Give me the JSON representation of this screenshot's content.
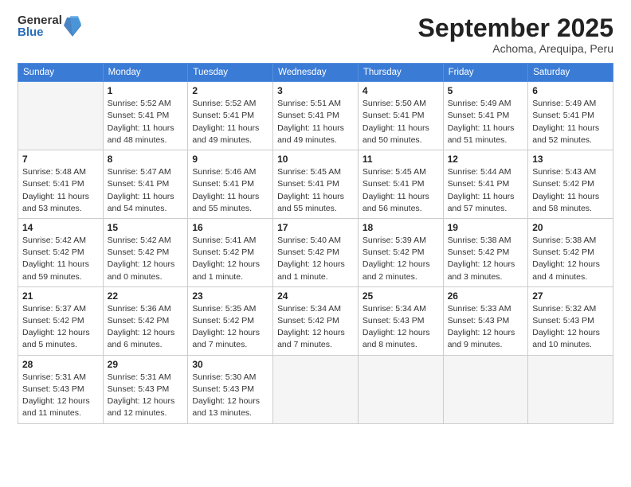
{
  "logo": {
    "general": "General",
    "blue": "Blue"
  },
  "title": "September 2025",
  "location": "Achoma, Arequipa, Peru",
  "days_of_week": [
    "Sunday",
    "Monday",
    "Tuesday",
    "Wednesday",
    "Thursday",
    "Friday",
    "Saturday"
  ],
  "weeks": [
    [
      {
        "day": "",
        "empty": true
      },
      {
        "day": "1",
        "sunrise": "Sunrise: 5:52 AM",
        "sunset": "Sunset: 5:41 PM",
        "daylight": "Daylight: 11 hours and 48 minutes."
      },
      {
        "day": "2",
        "sunrise": "Sunrise: 5:52 AM",
        "sunset": "Sunset: 5:41 PM",
        "daylight": "Daylight: 11 hours and 49 minutes."
      },
      {
        "day": "3",
        "sunrise": "Sunrise: 5:51 AM",
        "sunset": "Sunset: 5:41 PM",
        "daylight": "Daylight: 11 hours and 49 minutes."
      },
      {
        "day": "4",
        "sunrise": "Sunrise: 5:50 AM",
        "sunset": "Sunset: 5:41 PM",
        "daylight": "Daylight: 11 hours and 50 minutes."
      },
      {
        "day": "5",
        "sunrise": "Sunrise: 5:49 AM",
        "sunset": "Sunset: 5:41 PM",
        "daylight": "Daylight: 11 hours and 51 minutes."
      },
      {
        "day": "6",
        "sunrise": "Sunrise: 5:49 AM",
        "sunset": "Sunset: 5:41 PM",
        "daylight": "Daylight: 11 hours and 52 minutes."
      }
    ],
    [
      {
        "day": "7",
        "sunrise": "Sunrise: 5:48 AM",
        "sunset": "Sunset: 5:41 PM",
        "daylight": "Daylight: 11 hours and 53 minutes."
      },
      {
        "day": "8",
        "sunrise": "Sunrise: 5:47 AM",
        "sunset": "Sunset: 5:41 PM",
        "daylight": "Daylight: 11 hours and 54 minutes."
      },
      {
        "day": "9",
        "sunrise": "Sunrise: 5:46 AM",
        "sunset": "Sunset: 5:41 PM",
        "daylight": "Daylight: 11 hours and 55 minutes."
      },
      {
        "day": "10",
        "sunrise": "Sunrise: 5:45 AM",
        "sunset": "Sunset: 5:41 PM",
        "daylight": "Daylight: 11 hours and 55 minutes."
      },
      {
        "day": "11",
        "sunrise": "Sunrise: 5:45 AM",
        "sunset": "Sunset: 5:41 PM",
        "daylight": "Daylight: 11 hours and 56 minutes."
      },
      {
        "day": "12",
        "sunrise": "Sunrise: 5:44 AM",
        "sunset": "Sunset: 5:41 PM",
        "daylight": "Daylight: 11 hours and 57 minutes."
      },
      {
        "day": "13",
        "sunrise": "Sunrise: 5:43 AM",
        "sunset": "Sunset: 5:42 PM",
        "daylight": "Daylight: 11 hours and 58 minutes."
      }
    ],
    [
      {
        "day": "14",
        "sunrise": "Sunrise: 5:42 AM",
        "sunset": "Sunset: 5:42 PM",
        "daylight": "Daylight: 11 hours and 59 minutes."
      },
      {
        "day": "15",
        "sunrise": "Sunrise: 5:42 AM",
        "sunset": "Sunset: 5:42 PM",
        "daylight": "Daylight: 12 hours and 0 minutes."
      },
      {
        "day": "16",
        "sunrise": "Sunrise: 5:41 AM",
        "sunset": "Sunset: 5:42 PM",
        "daylight": "Daylight: 12 hours and 1 minute."
      },
      {
        "day": "17",
        "sunrise": "Sunrise: 5:40 AM",
        "sunset": "Sunset: 5:42 PM",
        "daylight": "Daylight: 12 hours and 1 minute."
      },
      {
        "day": "18",
        "sunrise": "Sunrise: 5:39 AM",
        "sunset": "Sunset: 5:42 PM",
        "daylight": "Daylight: 12 hours and 2 minutes."
      },
      {
        "day": "19",
        "sunrise": "Sunrise: 5:38 AM",
        "sunset": "Sunset: 5:42 PM",
        "daylight": "Daylight: 12 hours and 3 minutes."
      },
      {
        "day": "20",
        "sunrise": "Sunrise: 5:38 AM",
        "sunset": "Sunset: 5:42 PM",
        "daylight": "Daylight: 12 hours and 4 minutes."
      }
    ],
    [
      {
        "day": "21",
        "sunrise": "Sunrise: 5:37 AM",
        "sunset": "Sunset: 5:42 PM",
        "daylight": "Daylight: 12 hours and 5 minutes."
      },
      {
        "day": "22",
        "sunrise": "Sunrise: 5:36 AM",
        "sunset": "Sunset: 5:42 PM",
        "daylight": "Daylight: 12 hours and 6 minutes."
      },
      {
        "day": "23",
        "sunrise": "Sunrise: 5:35 AM",
        "sunset": "Sunset: 5:42 PM",
        "daylight": "Daylight: 12 hours and 7 minutes."
      },
      {
        "day": "24",
        "sunrise": "Sunrise: 5:34 AM",
        "sunset": "Sunset: 5:42 PM",
        "daylight": "Daylight: 12 hours and 7 minutes."
      },
      {
        "day": "25",
        "sunrise": "Sunrise: 5:34 AM",
        "sunset": "Sunset: 5:43 PM",
        "daylight": "Daylight: 12 hours and 8 minutes."
      },
      {
        "day": "26",
        "sunrise": "Sunrise: 5:33 AM",
        "sunset": "Sunset: 5:43 PM",
        "daylight": "Daylight: 12 hours and 9 minutes."
      },
      {
        "day": "27",
        "sunrise": "Sunrise: 5:32 AM",
        "sunset": "Sunset: 5:43 PM",
        "daylight": "Daylight: 12 hours and 10 minutes."
      }
    ],
    [
      {
        "day": "28",
        "sunrise": "Sunrise: 5:31 AM",
        "sunset": "Sunset: 5:43 PM",
        "daylight": "Daylight: 12 hours and 11 minutes."
      },
      {
        "day": "29",
        "sunrise": "Sunrise: 5:31 AM",
        "sunset": "Sunset: 5:43 PM",
        "daylight": "Daylight: 12 hours and 12 minutes."
      },
      {
        "day": "30",
        "sunrise": "Sunrise: 5:30 AM",
        "sunset": "Sunset: 5:43 PM",
        "daylight": "Daylight: 12 hours and 13 minutes."
      },
      {
        "day": "",
        "empty": true
      },
      {
        "day": "",
        "empty": true
      },
      {
        "day": "",
        "empty": true
      },
      {
        "day": "",
        "empty": true
      }
    ]
  ]
}
